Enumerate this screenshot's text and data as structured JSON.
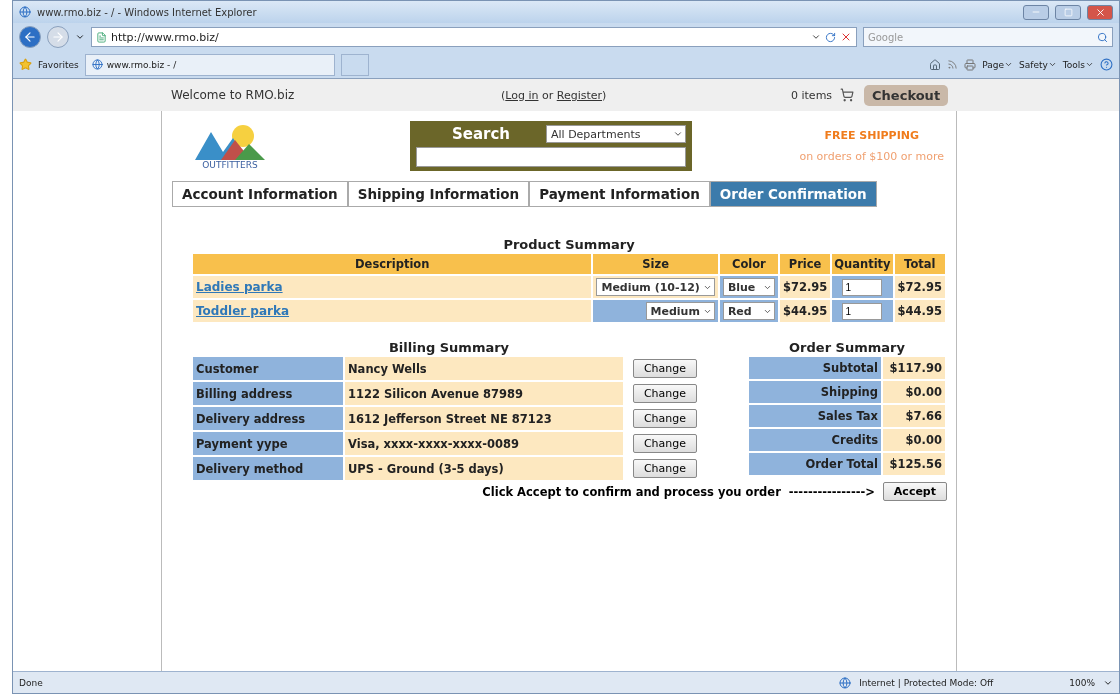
{
  "window": {
    "title": "www.rmo.biz - / - Windows Internet Explorer"
  },
  "address_bar": {
    "url": "http://www.rmo.biz/",
    "search_placeholder": "Google"
  },
  "favorites": {
    "label": "Favorites",
    "tab": "www.rmo.biz - /"
  },
  "command_bar": [
    "Page",
    "Safety",
    "Tools"
  ],
  "site_header": {
    "welcome": "Welcome to RMO.biz",
    "paren_open": "(",
    "login": "Log in",
    "or": "or",
    "register": "Register",
    "paren_close": ")",
    "items": "0 items",
    "checkout": "Checkout"
  },
  "logo": {
    "text": "OUTFITTERS"
  },
  "search": {
    "label": "Search",
    "department": "All Departments"
  },
  "promo": {
    "title": "FREE SHIPPING",
    "subtitle": "on orders of $100 or more"
  },
  "tabs": [
    {
      "label": "Account Information",
      "selected": false
    },
    {
      "label": "Shipping Information",
      "selected": false
    },
    {
      "label": "Payment Information",
      "selected": false
    },
    {
      "label": "Order Confirmation",
      "selected": true
    }
  ],
  "product_summary": {
    "title": "Product Summary",
    "columns": [
      "Description",
      "Size",
      "Color",
      "Price",
      "Quantity",
      "Total"
    ],
    "rows": [
      {
        "description": "Ladies parka",
        "size": "Medium (10-12)",
        "color_option": "Blue",
        "price": "$72.95",
        "quantity": "1",
        "total": "$72.95"
      },
      {
        "description": "Toddler parka",
        "size": "Medium",
        "color_option": "Red",
        "price": "$44.95",
        "quantity": "1",
        "total": "$44.95"
      }
    ]
  },
  "billing_summary": {
    "title": "Billing Summary",
    "rows": [
      {
        "label": "Customer",
        "value": "Nancy Wells",
        "button": "Change"
      },
      {
        "label": "Billing address",
        "value": "1122 Silicon Avenue  87989",
        "button": "Change"
      },
      {
        "label": "Delivery address",
        "value": "1612 Jefferson Street NE 87123",
        "button": "Change"
      },
      {
        "label": "Payment yype",
        "value": "Visa, xxxx-xxxx-xxxx-0089",
        "button": "Change"
      },
      {
        "label": "Delivery method",
        "value": "UPS - Ground (3-5 days)",
        "button": "Change"
      }
    ]
  },
  "order_summary": {
    "title": "Order Summary",
    "rows": [
      {
        "label": "Subtotal",
        "value": "$117.90"
      },
      {
        "label": "Shipping",
        "value": "$0.00"
      },
      {
        "label": "Sales Tax",
        "value": "$7.66"
      },
      {
        "label": "Credits",
        "value": "$0.00"
      },
      {
        "label": "Order Total",
        "value": "$125.56"
      }
    ]
  },
  "accept": {
    "prompt": "Click Accept to confirm and process you order",
    "arrow": "---------------->",
    "button": "Accept"
  },
  "status_bar": {
    "status": "Done",
    "zone": "Internet | Protected Mode: Off",
    "zoom": "100%"
  }
}
